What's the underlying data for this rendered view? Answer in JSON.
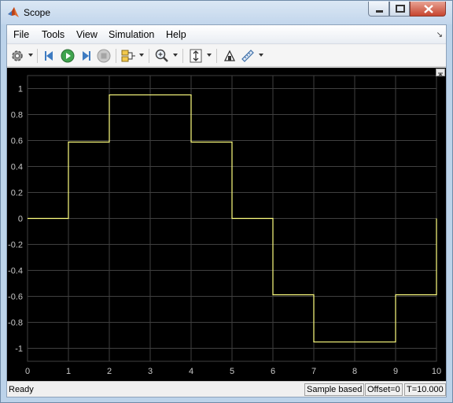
{
  "window": {
    "title": "Scope"
  },
  "menu": [
    {
      "label": "File"
    },
    {
      "label": "Tools"
    },
    {
      "label": "View"
    },
    {
      "label": "Simulation"
    },
    {
      "label": "Help"
    }
  ],
  "toolbar": {
    "icons": [
      "settings-icon",
      "step-back-icon",
      "run-icon",
      "step-forward-icon",
      "stop-icon",
      "signal-selector-icon",
      "zoom-icon",
      "autoscale-icon",
      "highlight-block-icon",
      "measurement-icon"
    ]
  },
  "status": {
    "ready": "Ready",
    "mode": "Sample based",
    "offset": "Offset=0",
    "time": "T=10.000"
  },
  "colors": {
    "plot_bg": "#000000",
    "grid": "#404040",
    "trace": "#ffff80",
    "axis_text": "#c8c8c8"
  },
  "chart_data": {
    "type": "line",
    "style": "step",
    "xlim": [
      0,
      10
    ],
    "ylim": [
      -1.1,
      1.1
    ],
    "xticks": [
      0,
      1,
      2,
      3,
      4,
      5,
      6,
      7,
      8,
      9,
      10
    ],
    "yticks": [
      -1,
      -0.8,
      -0.6,
      -0.4,
      -0.2,
      0,
      0.2,
      0.4,
      0.6,
      0.8,
      1
    ],
    "ytick_labels": [
      "-1",
      "-0.8",
      "-0.6",
      "-0.4",
      "-0.2",
      "0",
      "0.2",
      "0.4",
      "0.6",
      "0.8",
      "1"
    ],
    "grid": true,
    "series": [
      {
        "x": [
          0,
          1,
          2,
          3,
          4,
          5,
          6,
          7,
          8,
          9,
          10
        ],
        "y": [
          0,
          0.588,
          0.951,
          0.951,
          0.588,
          0,
          -0.588,
          -0.951,
          -0.951,
          -0.588,
          0
        ]
      }
    ]
  }
}
